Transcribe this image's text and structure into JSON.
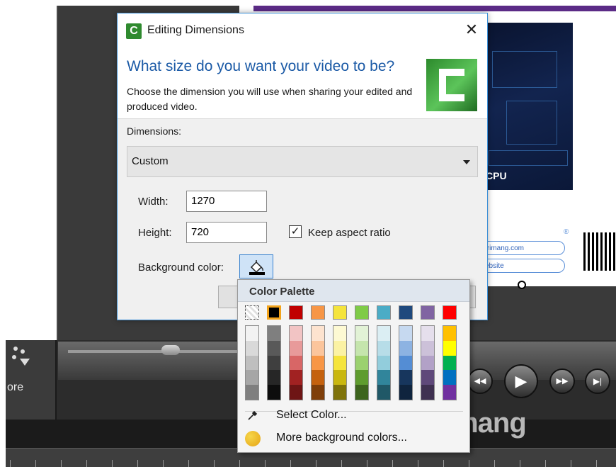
{
  "dialog": {
    "title": "Editing Dimensions",
    "close_glyph": "✕",
    "headline": "What size do you want your video to be?",
    "description": "Choose the dimension you will use when sharing your edited and produced video.",
    "dimensions_label": "Dimensions:",
    "dimensions_value": "Custom",
    "width_label": "Width:",
    "width_value": "1270",
    "height_label": "Height:",
    "height_value": "720",
    "keep_aspect_label": "Keep aspect ratio",
    "keep_aspect_checked": true,
    "background_color_label": "Background color:"
  },
  "palette": {
    "title": "Color Palette",
    "top_row": [
      "none",
      "#000000",
      "#c00000",
      "#f79646",
      "#f5e43c",
      "#7fcb48",
      "#4bacc6",
      "#1f497d",
      "#8064a2",
      "#ff0000"
    ],
    "columns": [
      [
        "#f2f2f2",
        "#d9d9d9",
        "#bfbfbf",
        "#a6a6a6",
        "#7f7f7f"
      ],
      [
        "#7f7f7f",
        "#595959",
        "#3f3f3f",
        "#262626",
        "#0d0d0d"
      ],
      [
        "#f2c4c4",
        "#e89a9a",
        "#d86666",
        "#a12222",
        "#6e1515"
      ],
      [
        "#fde3cf",
        "#fbc59c",
        "#f79646",
        "#c4620f",
        "#7f3f0a"
      ],
      [
        "#fdf9d3",
        "#fbf2a4",
        "#f5e43c",
        "#c9b70f",
        "#7f730a"
      ],
      [
        "#e2f2d6",
        "#c5e5ad",
        "#9bd16f",
        "#5f9c2e",
        "#3d641d"
      ],
      [
        "#dbeef3",
        "#b7dde8",
        "#92cddc",
        "#31859b",
        "#205867"
      ],
      [
        "#c6d9f0",
        "#8db3e2",
        "#548dd4",
        "#17365d",
        "#0f243e"
      ],
      [
        "#e5dfec",
        "#ccc1d9",
        "#b2a1c7",
        "#5f497a",
        "#3f3151"
      ],
      [
        "#ffc000",
        "#ffff00",
        "#00b050",
        "#0070c0",
        "#7030a0"
      ]
    ],
    "select_color_label": "Select Color...",
    "more_colors_label": "More background colors..."
  },
  "background": {
    "more_label": "ore",
    "cpu_label": "CPU",
    "pill_1_text": "trimang.com",
    "pill_2_text": "ebsite",
    "registered_mark": "®",
    "watermark_text": "uantrimang"
  },
  "player": {
    "prev_glyph": "◀◀",
    "play_glyph": "▶",
    "next_glyph": "▶▶",
    "end_glyph": "▶|"
  }
}
